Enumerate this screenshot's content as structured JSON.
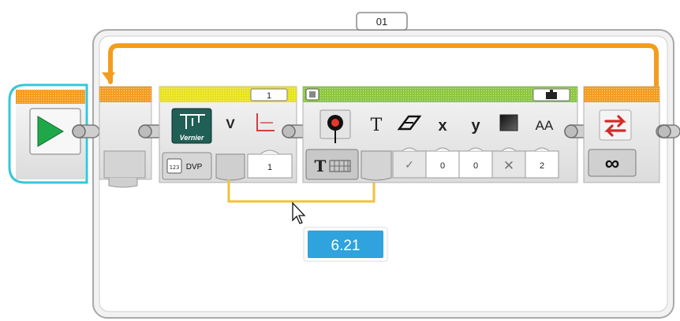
{
  "loop": {
    "name": "01",
    "mode_icon": "infinity-icon",
    "repeat_icon": "loop-arrows-icon"
  },
  "start_block": {
    "icon": "play-triangle-icon"
  },
  "sensor_block": {
    "brand_label": "Vernier",
    "port": "1",
    "sensor_icon": "vernier-caliper-icon",
    "mode_label": "DVP",
    "measure_label": "V",
    "measure_icon": "axis-graph-icon",
    "input_value": "1"
  },
  "display_block": {
    "header_icon": "display-brick-icon",
    "mode_icon": "text-grid-icon",
    "param_icons": [
      "clear-screen-icon",
      "text-T-icon",
      "eraser-icon",
      "x-coordinate-icon",
      "y-coordinate-icon",
      "color-square-icon",
      "font-size-icon"
    ],
    "param_labels": [
      "T",
      "x",
      "y",
      "AA"
    ],
    "clear_value": "✓",
    "x_value": "0",
    "y_value": "0",
    "color_value": "✕",
    "font_value": "2"
  },
  "data_wire": {
    "bubble_value": "6.21"
  },
  "colors": {
    "loop_orange": "#F39C1F",
    "sensor_yellow": "#E8E21E",
    "display_green": "#8CC63F",
    "start_cyan": "#36C7D8",
    "bubble_blue": "#2EA3DD",
    "wire_yellow": "#F0C23A",
    "block_gray": "#EDEDED"
  }
}
